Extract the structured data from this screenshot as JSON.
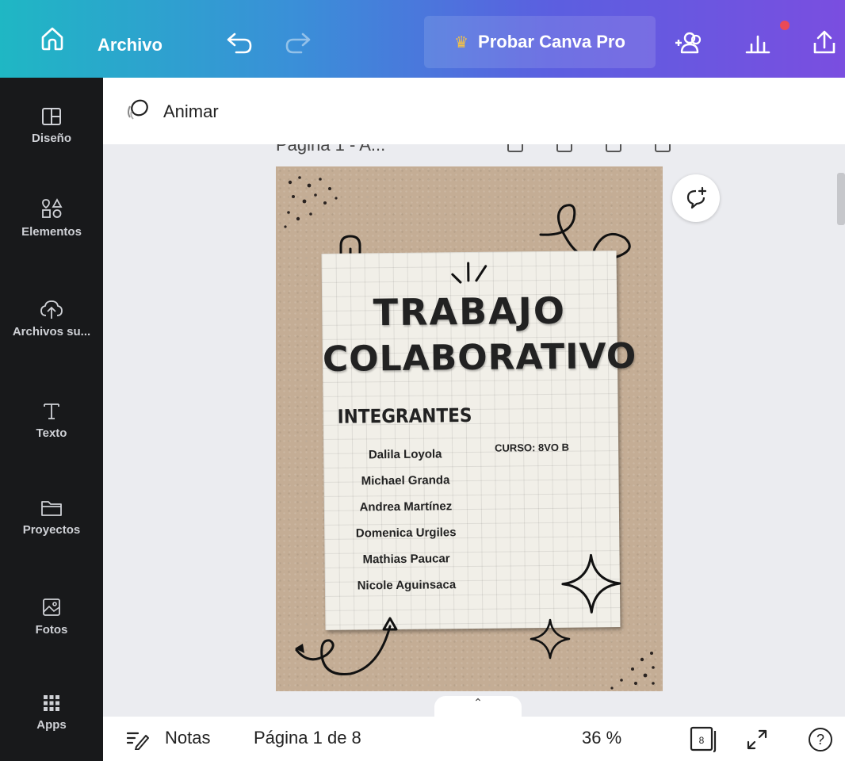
{
  "topbar": {
    "archivo_label": "Archivo",
    "pro_label": "Probar Canva Pro",
    "crown_glyph": "♛",
    "notification_color": "#e94a57"
  },
  "sidebar": {
    "items": [
      {
        "label": "Diseño",
        "icon": "layout-icon"
      },
      {
        "label": "Elementos",
        "icon": "shapes-icon"
      },
      {
        "label": "Archivos su...",
        "icon": "cloud-upload-icon"
      },
      {
        "label": "Texto",
        "icon": "text-icon"
      },
      {
        "label": "Proyectos",
        "icon": "folder-icon"
      },
      {
        "label": "Fotos",
        "icon": "image-icon"
      },
      {
        "label": "Apps",
        "icon": "apps-grid-icon"
      }
    ]
  },
  "toolbar": {
    "animar_label": "Animar"
  },
  "canvas": {
    "page_header": "Página 1 - A...",
    "title_line1": "TRABAJO",
    "title_line2": "COLABORATIVO",
    "integrantes_label": "INTEGRANTES",
    "curso": "CURSO: 8VO B",
    "members": [
      "Dalila Loyola",
      "Michael Granda",
      "Andrea Martínez",
      "Domenica Urgiles",
      "Mathias Paucar",
      "Nicole Aguinsaca"
    ]
  },
  "bottombar": {
    "notes_label": "Notas",
    "page_indicator": "Página 1 de 8",
    "zoom": "36 %",
    "page_count": "8",
    "help_glyph": "?",
    "handle_glyph": "⌃"
  }
}
